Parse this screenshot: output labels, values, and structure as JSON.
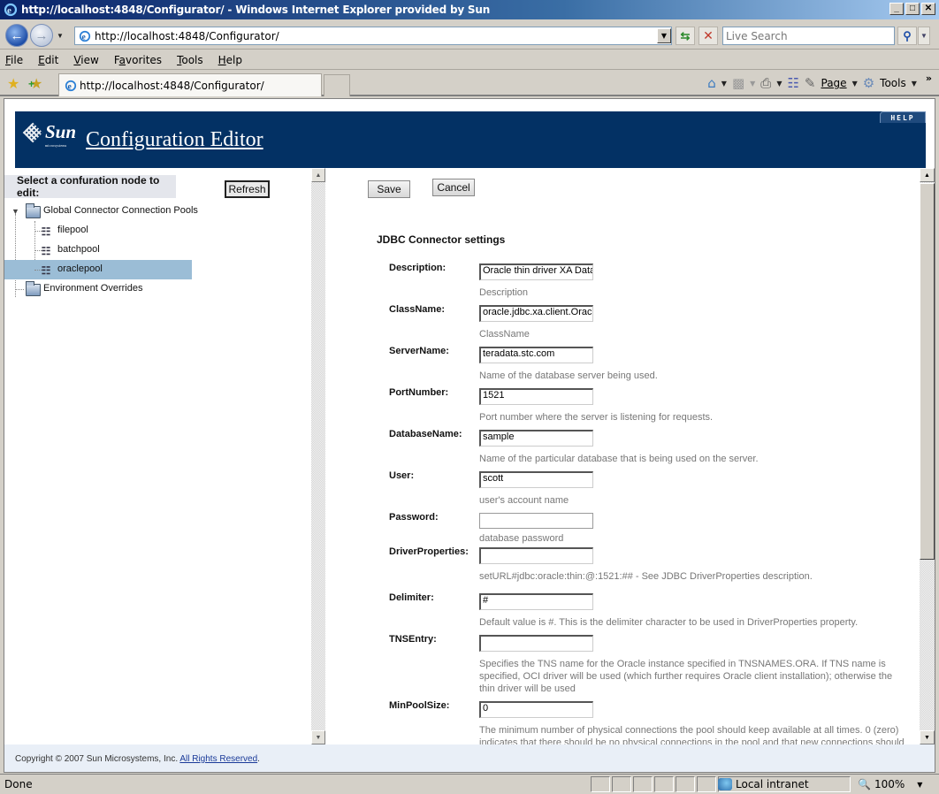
{
  "window": {
    "title": "http://localhost:4848/Configurator/ - Windows Internet Explorer provided by Sun",
    "minimize": "_",
    "maximize": "□",
    "close": "✕"
  },
  "navbar": {
    "address": "http://localhost:4848/Configurator/",
    "search_placeholder": "Live Search"
  },
  "menu": {
    "items": [
      {
        "label": "File",
        "accel": "F",
        "rest": "ile"
      },
      {
        "label": "Edit",
        "accel": "E",
        "rest": "dit"
      },
      {
        "label": "View",
        "accel": "V",
        "rest": "iew"
      },
      {
        "label": "Favorites",
        "accel_pre": "F",
        "accel": "a",
        "rest": "vorites"
      },
      {
        "label": "Tools",
        "accel": "T",
        "rest": "ools"
      },
      {
        "label": "Help",
        "accel": "H",
        "rest": "elp"
      }
    ]
  },
  "tabs": {
    "active_tab": "http://localhost:4848/Configurator/"
  },
  "command_bar": {
    "page_label": "Page",
    "tools_label": "Tools",
    "more": "»"
  },
  "banner": {
    "logo_text": "Sun",
    "logo_sub": "microsystems",
    "app_title": "Configuration Editor",
    "help_label": "HELP",
    "brand_color": "#033164"
  },
  "left_pane": {
    "select_label": "Select a confuration node to edit:",
    "refresh_label": "Refresh",
    "tree": {
      "global_pools": "Global Connector Connection Pools",
      "pools": [
        "filepool",
        "batchpool",
        "oraclepool"
      ],
      "selected": "oraclepool",
      "env_overrides": "Environment Overrides"
    }
  },
  "right_pane": {
    "save_label": "Save",
    "cancel_label": "Cancel",
    "section_title": "JDBC Connector settings",
    "fields": [
      {
        "label": "Description:",
        "value": "Oracle thin driver XA Data",
        "help": "Description"
      },
      {
        "label": "ClassName:",
        "value": "oracle.jdbc.xa.client.Oracl",
        "help": "ClassName"
      },
      {
        "label": "ServerName:",
        "value": "teradata.stc.com",
        "help": "Name of the database server being used."
      },
      {
        "label": "PortNumber:",
        "value": "1521",
        "help": "Port number where the server is listening for requests."
      },
      {
        "label": "DatabaseName:",
        "value": "sample",
        "help": "Name of the particular database that is being used on the server."
      },
      {
        "label": "User:",
        "value": "scott",
        "help": "user's account name"
      },
      {
        "label": "Password:",
        "value": "",
        "help": "database password"
      },
      {
        "label": "DriverProperties:",
        "value": "",
        "help": "setURL#jdbc:oracle:thin:@:1521:## - See JDBC DriverProperties description."
      },
      {
        "label": "Delimiter:",
        "value": "#",
        "help": "Default value is #. This is the delimiter character to be used in DriverProperties property."
      },
      {
        "label": "TNSEntry:",
        "value": "",
        "help": "Specifies the TNS name for the Oracle instance specified in TNSNAMES.ORA. If TNS name is specified, OCI driver will be used (which further requires Oracle client installation); otherwise the thin driver will be used"
      },
      {
        "label": "MinPoolSize:",
        "value": "0",
        "help": "The minimum number of physical connections the pool should keep available at all times. 0 (zero) indicates that there should be no physical connections in the pool and that new connections should"
      }
    ]
  },
  "footer": {
    "copyright": "Copyright © 2007 Sun Microsystems, Inc. ",
    "rights_link": "All Rights Reserved",
    "period": "."
  },
  "statusbar": {
    "status": "Done",
    "zone": "Local intranet",
    "zoom": "100%"
  }
}
